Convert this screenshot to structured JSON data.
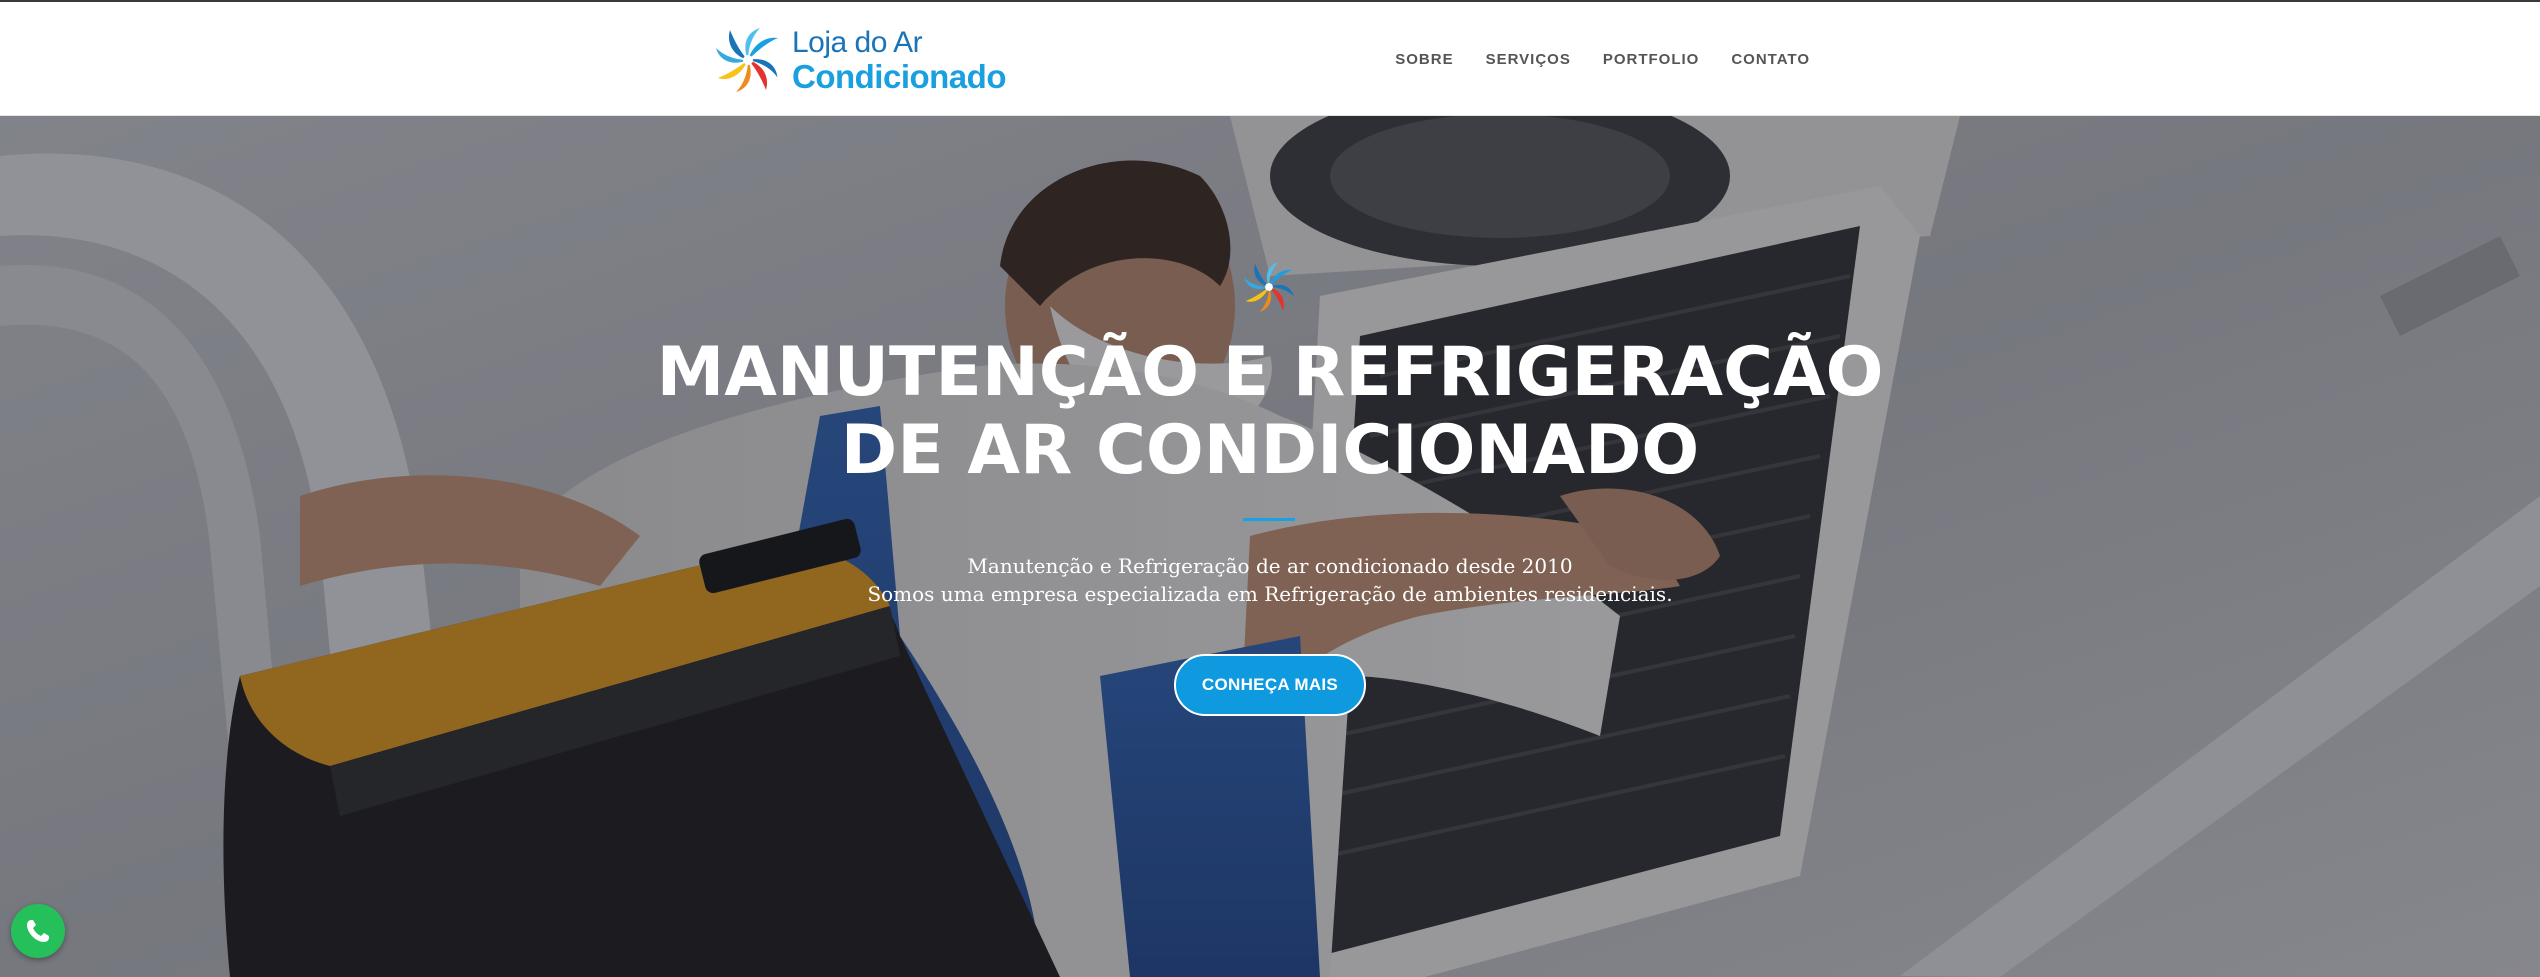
{
  "header": {
    "logo": {
      "line1": "Loja do Ar",
      "line2": "Condicionado"
    },
    "nav": [
      {
        "label": "SOBRE"
      },
      {
        "label": "SERVIÇOS"
      },
      {
        "label": "PORTFOLIO"
      },
      {
        "label": "CONTATO"
      }
    ]
  },
  "hero": {
    "title_line1": "MANUTENÇÃO E REFRIGERAÇÃO",
    "title_line2": "DE AR CONDICIONADO",
    "subtitle_line1": "Manutenção e Refrigeração de ar condicionado desde 2010",
    "subtitle_line2": "Somos uma empresa especializada em Refrigeração de ambientes residenciais.",
    "button_label": "CONHEÇA MAIS"
  },
  "icons": {
    "logo": "swirl-logo-icon",
    "hero": "swirl-logo-icon",
    "floating": "whatsapp-icon"
  },
  "colors": {
    "accent": "#0f9ae0",
    "logo_dark_blue": "#1a74b8",
    "logo_light_blue": "#1aa0e0",
    "nav_text": "#555555",
    "whatsapp": "#25c05a"
  }
}
